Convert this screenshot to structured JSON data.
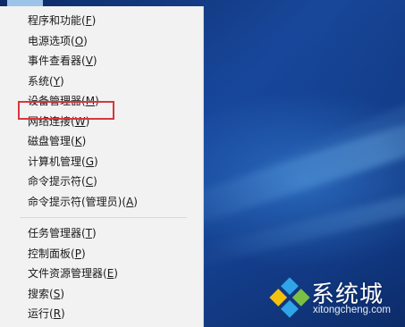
{
  "menu": {
    "items": [
      {
        "label": "程序和功能",
        "accel": "F"
      },
      {
        "label": "电源选项",
        "accel": "O"
      },
      {
        "label": "事件查看器",
        "accel": "V"
      },
      {
        "label": "系统",
        "accel": "Y"
      },
      {
        "label": "设备管理器",
        "accel": "M",
        "highlighted": true
      },
      {
        "label": "网络连接",
        "accel": "W"
      },
      {
        "label": "磁盘管理",
        "accel": "K"
      },
      {
        "label": "计算机管理",
        "accel": "G"
      },
      {
        "label": "命令提示符",
        "accel": "C"
      },
      {
        "label": "命令提示符(管理员)",
        "accel": "A"
      },
      {
        "label": "任务管理器",
        "accel": "T"
      },
      {
        "label": "控制面板",
        "accel": "P"
      },
      {
        "label": "文件资源管理器",
        "accel": "E"
      },
      {
        "label": "搜索",
        "accel": "S"
      },
      {
        "label": "运行",
        "accel": "R"
      }
    ]
  },
  "watermark": {
    "brand": "系统城",
    "url": "xitongcheng.com"
  },
  "colors": {
    "highlight_border": "#d9363e",
    "menu_background": "#f2f2f2",
    "desktop": "#1b3f86"
  }
}
